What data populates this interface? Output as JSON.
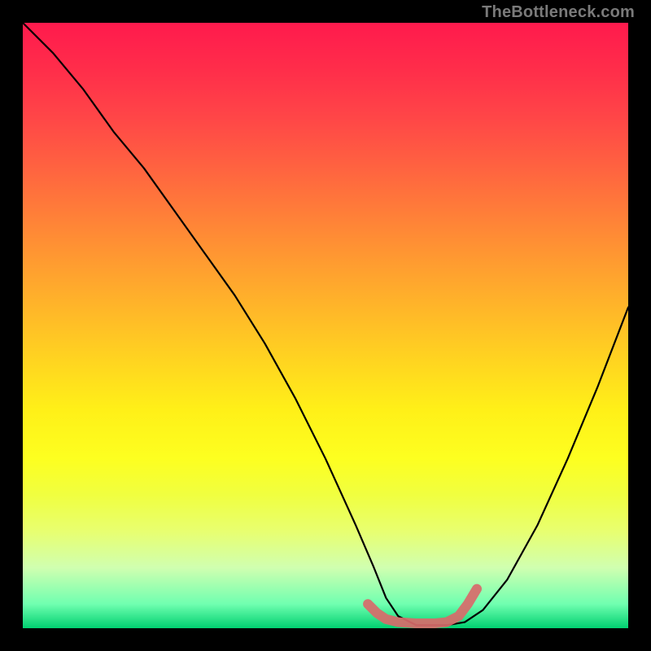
{
  "watermark": "TheBottleneck.com",
  "chart_data": {
    "type": "line",
    "title": "",
    "xlabel": "",
    "ylabel": "",
    "xlim": [
      0,
      100
    ],
    "ylim": [
      0,
      100
    ],
    "series": [
      {
        "name": "bottleneck-curve",
        "x": [
          0,
          5,
          10,
          15,
          20,
          25,
          30,
          35,
          40,
          45,
          50,
          55,
          58,
          60,
          62,
          65,
          68,
          70,
          73,
          76,
          80,
          85,
          90,
          95,
          100
        ],
        "y": [
          100,
          95,
          89,
          82,
          76,
          69,
          62,
          55,
          47,
          38,
          28,
          17,
          10,
          5,
          2,
          0.5,
          0.5,
          0.5,
          1,
          3,
          8,
          17,
          28,
          40,
          53
        ],
        "color": "#000000"
      },
      {
        "name": "optimal-range-marker",
        "x": [
          57,
          58.5,
          60,
          62,
          65,
          68,
          70,
          72,
          73.5,
          75
        ],
        "y": [
          4,
          2.5,
          1.5,
          1,
          0.8,
          0.8,
          1,
          2,
          4,
          6.5
        ],
        "color": "#d86a6a"
      }
    ],
    "background_gradient": {
      "top": "#ff1a4d",
      "middle": "#fff018",
      "bottom": "#00d070"
    }
  }
}
